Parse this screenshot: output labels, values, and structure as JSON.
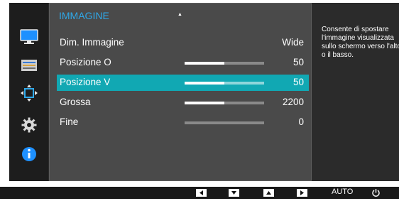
{
  "menu": {
    "title": "IMMAGINE",
    "rows": [
      {
        "label": "Dim. Immagine",
        "value": "Wide",
        "slider": null
      },
      {
        "label": "Posizione O",
        "value": "50",
        "slider": 0.5
      },
      {
        "label": "Posizione V",
        "value": "50",
        "slider": 0.5,
        "selected": true
      },
      {
        "label": "Grossa",
        "value": "2200",
        "slider": 0.5
      },
      {
        "label": "Fine",
        "value": "0",
        "slider": 0
      }
    ]
  },
  "description": "Consente di spostare l'immagine visualizzata sullo schermo verso l'alto o il basso.",
  "sidebar": {
    "icons": [
      "monitor-icon",
      "color-bars-icon",
      "resize-arrows-icon",
      "gear-icon",
      "info-icon"
    ],
    "active_color": "#1e90ff"
  },
  "bottom_bar": {
    "keys": [
      "left-arrow-icon",
      "down-arrow-icon",
      "up-arrow-icon",
      "right-arrow-icon"
    ],
    "auto_label": "AUTO",
    "power_icon": "power-icon"
  },
  "colors": {
    "accent": "#11a8b3",
    "title": "#2fa8e8"
  }
}
